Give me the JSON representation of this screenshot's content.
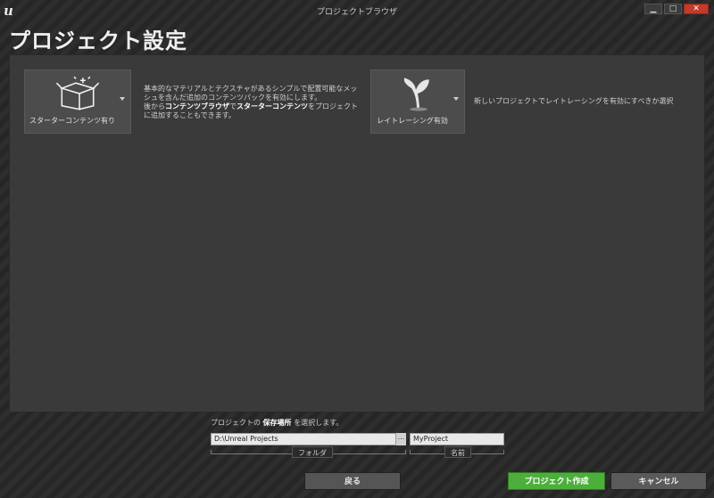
{
  "window": {
    "title": "プロジェクトブラウザ",
    "controls": {
      "minimize": "▁",
      "maximize": "□",
      "close": "✕"
    }
  },
  "page": {
    "title": "プロジェクト設定"
  },
  "options": {
    "starter": {
      "label": "スターターコンテンツ有り",
      "icon": "box-sparkle-icon",
      "description_line1": "基本的なマテリアルとテクスチャがあるシンプルで配置可能なメッシュを含んだ追加のコンテンツパックを有効にします。",
      "description_pre": "後から",
      "description_bold1": "コンテンツブラウザ",
      "description_mid": "で",
      "description_bold2": "スターターコンテンツ",
      "description_post": "をプロジェクトに追加することもできます。"
    },
    "raytracing": {
      "label": "レイトレーシング有効",
      "icon": "sprout-icon",
      "description": "新しいプロジェクトでレイトレーシングを有効にすべきか選択"
    }
  },
  "location": {
    "label_pre": "プロジェクトの",
    "label_bold": "保存場所",
    "label_post": "を選択します。",
    "folder_value": "D:\\Unreal Projects",
    "browse_label": "...",
    "name_value": "MyProject",
    "folder_caption": "フォルダ",
    "name_caption": "名前"
  },
  "buttons": {
    "back": "戻る",
    "create": "プロジェクト作成",
    "cancel": "キャンセル"
  }
}
